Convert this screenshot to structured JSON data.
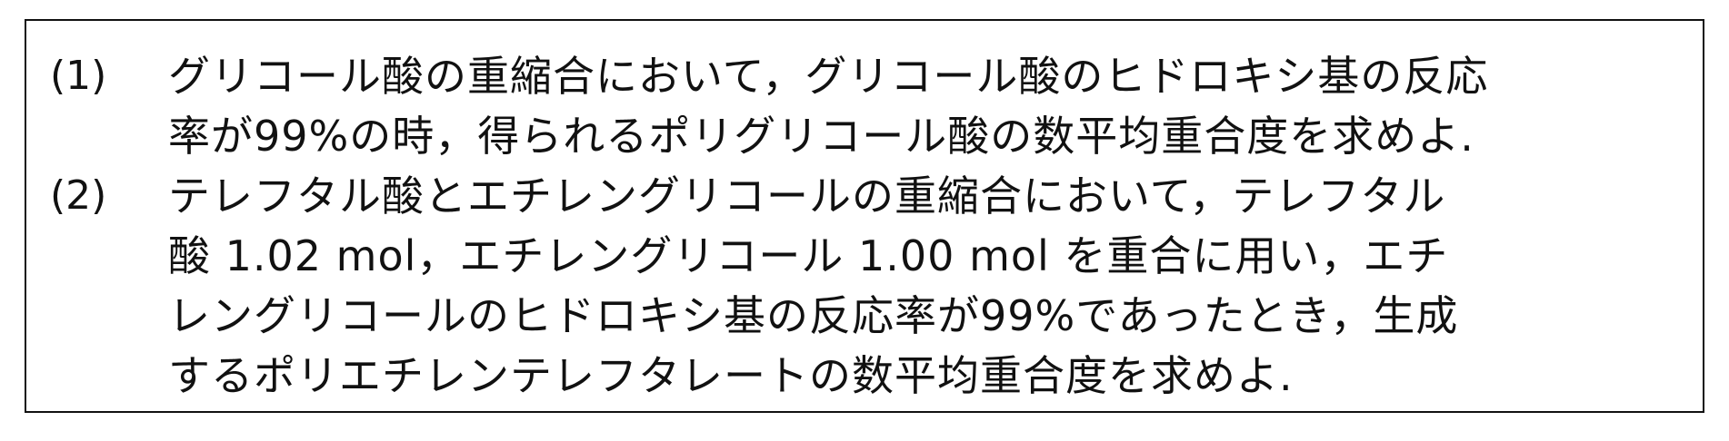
{
  "questions": [
    {
      "number": "(1)",
      "lines": [
        "グリコール酸の重縮合において，グリコール酸のヒドロキシ基の反応",
        "率が99%の時，得られるポリグリコール酸の数平均重合度を求めよ."
      ]
    },
    {
      "number": "(2)",
      "lines": [
        "テレフタル酸とエチレングリコールの重縮合において，テレフタル",
        "酸 1.02 mol，エチレングリコール 1.00 mol を重合に用い，エチ",
        "レングリコールのヒドロキシ基の反応率が99%であったとき，生成",
        "するポリエチレンテレフタレートの数平均重合度を求めよ."
      ]
    }
  ]
}
